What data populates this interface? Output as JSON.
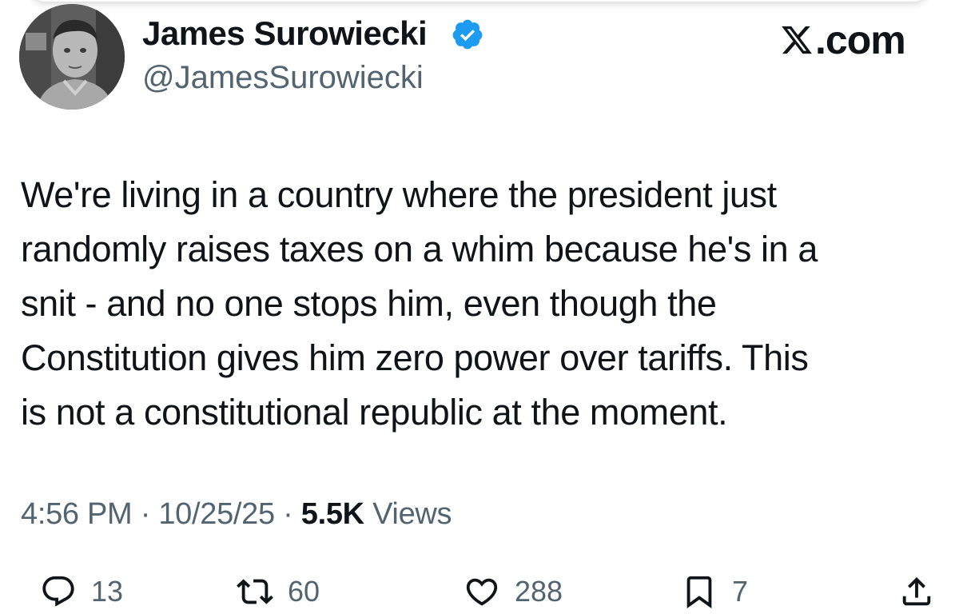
{
  "author": {
    "name": "James Surowiecki",
    "handle": "@JamesSurowiecki",
    "verified": true,
    "badge_color": "#1d9bf0"
  },
  "site": {
    "x_mark": "X",
    "suffix": ".com"
  },
  "tweet": {
    "lines": [
      "We're living in a country where the president just",
      "randomly raises taxes on a whim because he's in a",
      "snit - and no one stops him, even though the",
      "Constitution gives him zero power over tariffs. This",
      "is not a constitutional republic at the moment."
    ]
  },
  "meta": {
    "time": "4:56 PM",
    "date": "10/25/25",
    "separator": "·",
    "views_count": "5.5K",
    "views_label": "Views"
  },
  "actions": {
    "reply_count": "13",
    "repost_count": "60",
    "like_count": "288",
    "bookmark_count": "7"
  },
  "icons": {
    "reply": "reply-bubble-icon",
    "repost": "repost-icon",
    "like": "heart-icon",
    "bookmark": "bookmark-icon",
    "share": "share-icon",
    "verified": "verified-badge-icon"
  },
  "colors": {
    "text": "#0f1419",
    "secondary": "#536471",
    "verified": "#1d9bf0"
  }
}
